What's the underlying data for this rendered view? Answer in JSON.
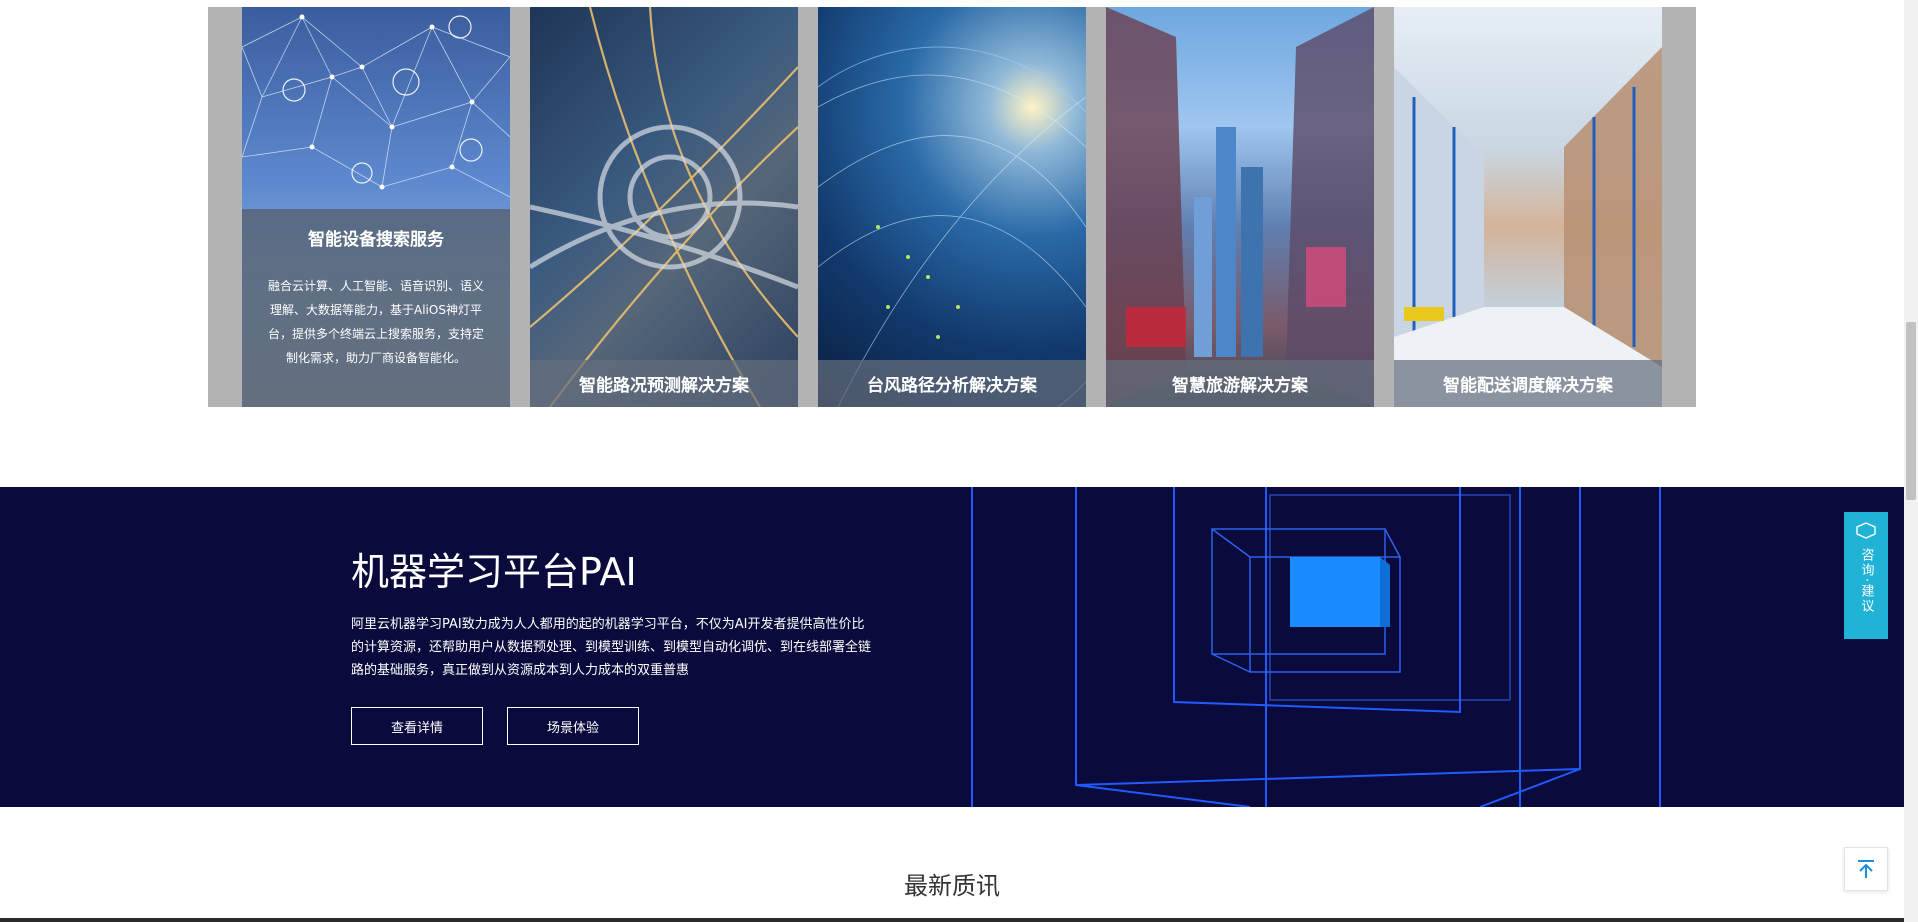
{
  "solutions": {
    "cards": [
      {
        "title": "智能设备搜索服务",
        "description": "融合云计算、人工智能、语音识别、语义理解、大数据等能力，基于AliOS神灯平台，提供多个终端云上搜索服务，支持定制化需求，助力厂商设备智能化。",
        "expanded": true
      },
      {
        "title": "智能路况预测解决方案",
        "expanded": false
      },
      {
        "title": "台风路径分析解决方案",
        "expanded": false
      },
      {
        "title": "智慧旅游解决方案",
        "expanded": false
      },
      {
        "title": "智能配送调度解决方案",
        "expanded": false
      }
    ]
  },
  "pai": {
    "title": "机器学习平台PAI",
    "description": "阿里云机器学习PAI致力成为人人都用的起的机器学习平台，不仅为AI开发者提供高性价比的计算资源，还帮助用户从数据预处理、到模型训练、到模型自动化调优、到在线部署全链路的基础服务，真正做到从资源成本到人力成本的双重普惠",
    "buttons": {
      "details": "查看详情",
      "experience": "场景体验"
    },
    "background_color": "#0b0a3c",
    "accent_color": "#1a8cff"
  },
  "news": {
    "title": "最新质讯"
  },
  "float_widgets": {
    "consult_label": "咨询·建议",
    "consult_color": "#21b3d6",
    "consult_icon": "chat-bubble-icon",
    "to_top_icon": "arrow-up-icon",
    "to_top_color": "#1a8fe0"
  }
}
